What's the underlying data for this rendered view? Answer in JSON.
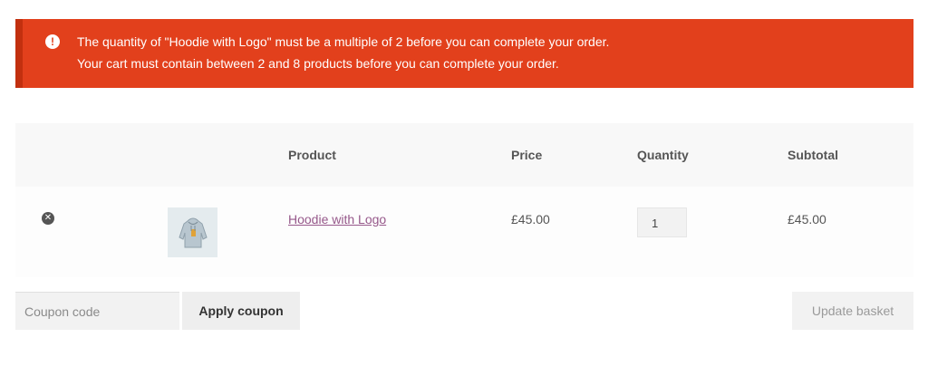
{
  "notice": {
    "icon": "exclamation-icon",
    "color": "#e2401c",
    "messages": [
      "The quantity of \"Hoodie with Logo\" must be a multiple of 2 before you can complete your order.",
      "Your cart must contain between 2 and 8 products before you can complete your order."
    ]
  },
  "cart": {
    "headers": {
      "product": "Product",
      "price": "Price",
      "quantity": "Quantity",
      "subtotal": "Subtotal"
    },
    "items": [
      {
        "remove_icon": "close-circle-icon",
        "thumbnail_icon": "hoodie-icon",
        "name": "Hoodie with Logo",
        "price": "£45.00",
        "quantity": "1",
        "subtotal": "£45.00"
      }
    ]
  },
  "actions": {
    "coupon_placeholder": "Coupon code",
    "apply_label": "Apply coupon",
    "update_label": "Update basket"
  },
  "colors": {
    "error": "#e2401c",
    "link": "#96588a"
  }
}
